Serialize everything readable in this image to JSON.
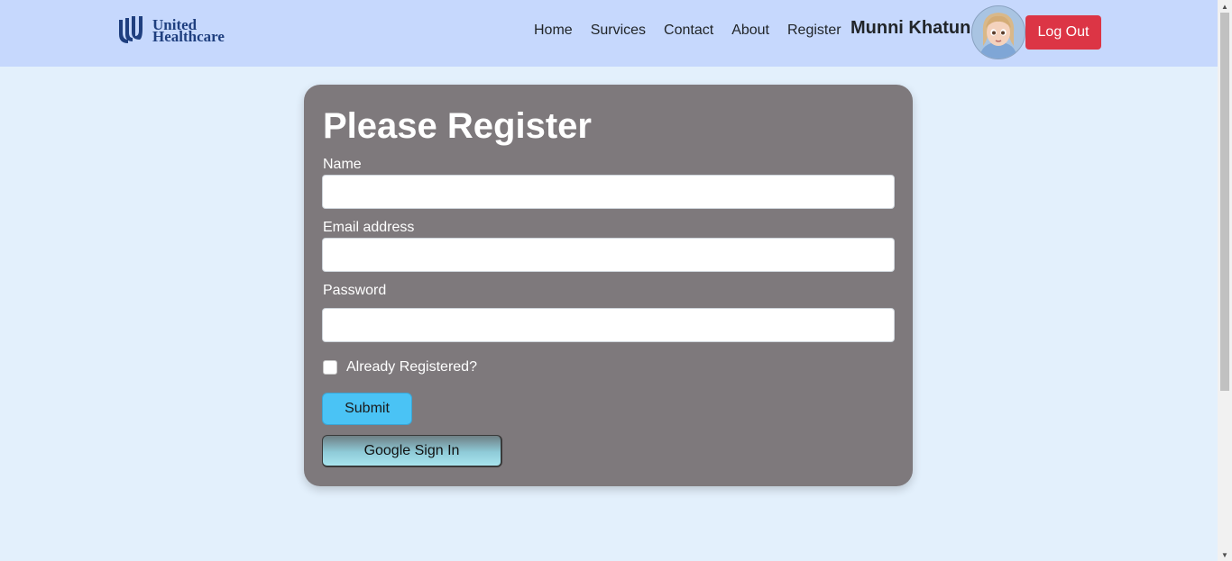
{
  "header": {
    "brand": {
      "line1": "United",
      "line2": "Healthcare",
      "icon": "united-healthcare-logo"
    },
    "nav": [
      {
        "label": "Home"
      },
      {
        "label": "Survices"
      },
      {
        "label": "Contact"
      },
      {
        "label": "About"
      },
      {
        "label": "Register"
      }
    ],
    "user_name": "Munni Khatun",
    "avatar_icon": "user-avatar",
    "logout_label": "Log Out"
  },
  "form": {
    "title": "Please Register",
    "name_label": "Name",
    "name_value": "",
    "email_label": "Email address",
    "email_value": "",
    "password_label": "Password",
    "password_value": "",
    "checkbox_label": "Already Registered?",
    "checkbox_checked": false,
    "submit_label": "Submit",
    "google_label": "Google Sign In"
  },
  "colors": {
    "navbar": "#c6d8fd",
    "page_bg": "#e3f0fc",
    "card_bg": "#7e797c",
    "logout": "#dc3545",
    "submit": "#4ac3f5"
  }
}
